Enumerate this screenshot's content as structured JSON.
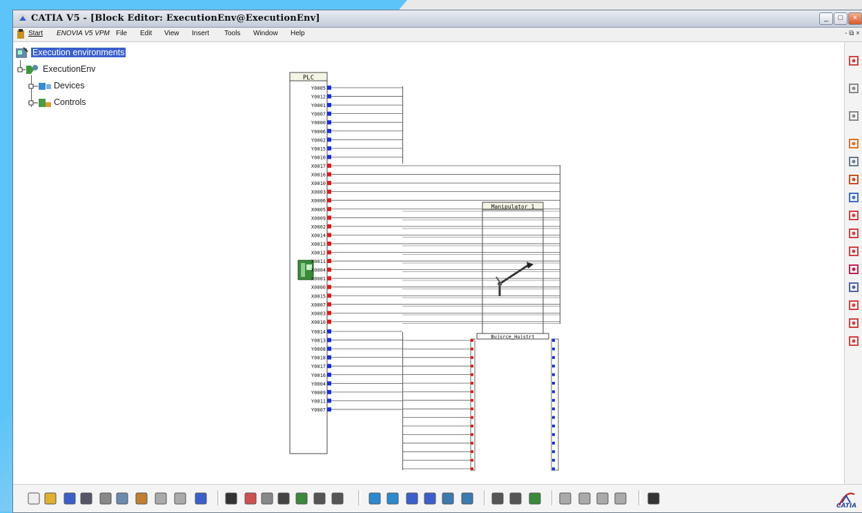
{
  "window": {
    "title": "CATIA V5 - [Block Editor: ExecutionEnv@ExecutionEnv]",
    "min_btn": "_",
    "restore_btn": "□",
    "close_btn": "×"
  },
  "menu": {
    "items": [
      "Start",
      "ENOVIA V5 VPM",
      "File",
      "Edit",
      "View",
      "Insert",
      "Tools",
      "Window",
      "Help"
    ],
    "doc_controls": "- ⧉ ×"
  },
  "tree": {
    "root": "Execution environments",
    "env": "ExecutionEnv",
    "devices": "Devices",
    "controls": "Controls"
  },
  "diagram": {
    "plc_title": "PLC",
    "manip_title": "Manipulator_1",
    "manip_port_label": "Bujsrce_Hujstrt",
    "plc_ports_top": [
      "Y0005",
      "Y0012",
      "Y0001",
      "Y0007",
      "Y0000",
      "Y0006",
      "Y0002",
      "Y0015",
      "Y0010"
    ],
    "plc_ports_mid": [
      "X0017",
      "X0016",
      "X0010",
      "X0003",
      "X0006",
      "X0005",
      "X0009",
      "X0002",
      "X0014",
      "X0013",
      "X0012",
      "X0011",
      "X0004",
      "X0001",
      "X0000",
      "X0015",
      "X0007",
      "X0003",
      "X0010"
    ],
    "plc_ports_bot": [
      "Y0014",
      "Y0013",
      "Y0008",
      "Y0018",
      "Y0017",
      "Y0016",
      "Y0004",
      "Y0009",
      "Y0011",
      "Y0007"
    ]
  },
  "colors": {
    "output_port": "#1a2ee0",
    "input_port": "#e01a1a",
    "selection": "#3a5fcd"
  },
  "right_toolbar_icons": [
    "fit-all-icon",
    "grid-icon",
    "grid2-icon",
    "select-arrow-icon",
    "rotate-icon",
    "export-icon",
    "connect-icon",
    "port-in-icon",
    "port-out-icon",
    "delete-port-icon",
    "link-icon",
    "chain-icon",
    "align-left-icon",
    "align-center-icon",
    "align-right-icon"
  ],
  "bottom_toolbar_icons": [
    "new-icon",
    "open-icon",
    "save-icon",
    "print-icon",
    "cut-icon",
    "copy-icon",
    "paste-icon",
    "undo-icon",
    "redo-icon",
    "whats-this-icon",
    "formula-icon",
    "comment-icon",
    "knowledge-icon",
    "table-icon",
    "tree-icon",
    "lock-icon",
    "catalog-icon",
    "fit-icon",
    "pan-icon",
    "zoom-in-icon",
    "zoom-out-icon",
    "view1-icon",
    "view2-icon",
    "gear-icon",
    "gears-icon",
    "person-icon",
    "swap-icon",
    "arrows-icon",
    "nav1-icon",
    "nav2-icon",
    "camera-icon"
  ],
  "catia_logo": "CATIA"
}
